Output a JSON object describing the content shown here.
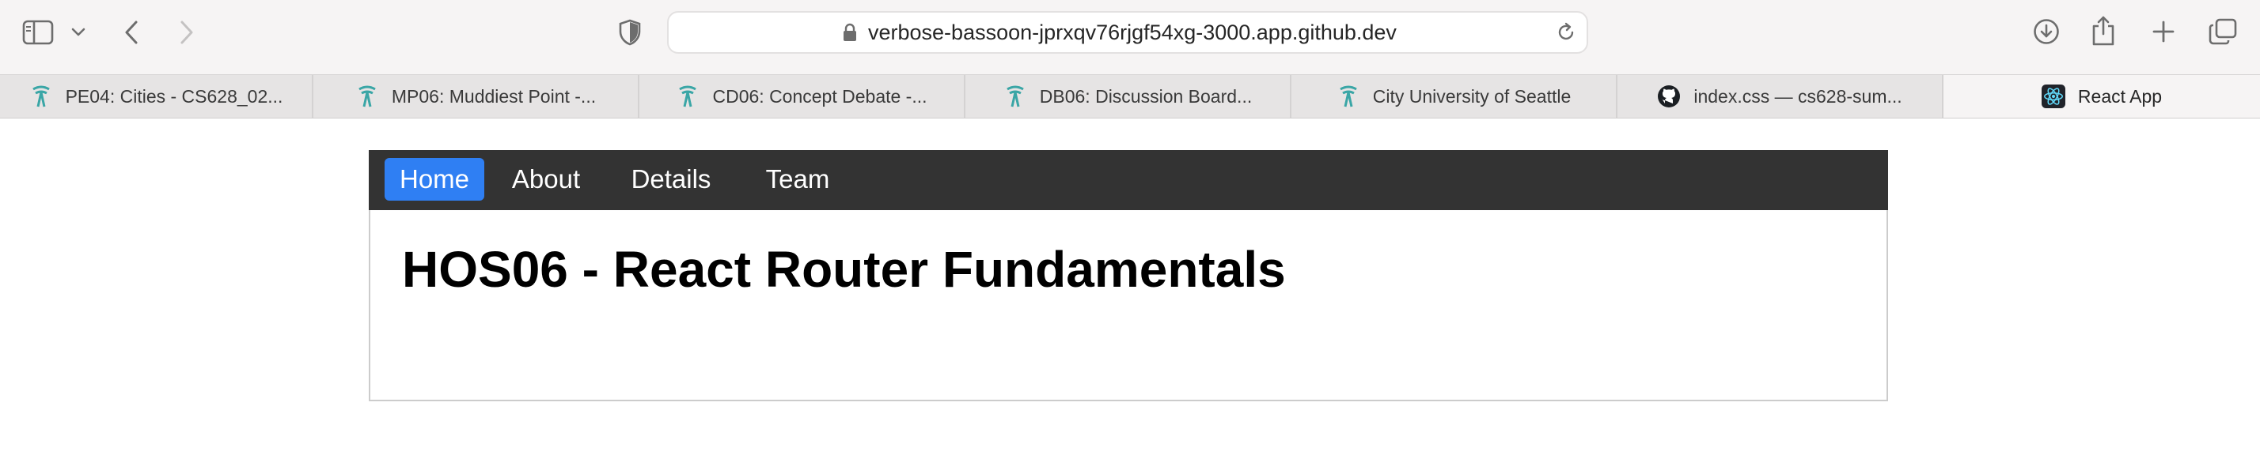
{
  "browser": {
    "url": "verbose-bassoon-jprxqv76rjgf54xg-3000.app.github.dev",
    "icons": [
      "sidebar-icon",
      "chevron-down-icon",
      "back-arrow-icon",
      "forward-arrow-icon",
      "shield-icon",
      "lock-icon",
      "reload-icon",
      "download-icon",
      "share-icon",
      "plus-icon",
      "tabs-overview-icon"
    ],
    "tabs": [
      {
        "label": "PE04: Cities - CS628_02...",
        "icon": "canvas-tower-icon"
      },
      {
        "label": "MP06: Muddiest Point -...",
        "icon": "canvas-tower-icon"
      },
      {
        "label": "CD06: Concept Debate -...",
        "icon": "canvas-tower-icon"
      },
      {
        "label": "DB06: Discussion Board...",
        "icon": "canvas-tower-icon"
      },
      {
        "label": "City University of Seattle",
        "icon": "canvas-tower-icon"
      },
      {
        "label": "index.css — cs628-sum...",
        "icon": "github-icon"
      },
      {
        "label": "React App",
        "icon": "react-icon",
        "active": true
      }
    ]
  },
  "app": {
    "nav": [
      {
        "label": "Home",
        "active": true
      },
      {
        "label": "About"
      },
      {
        "label": "Details"
      },
      {
        "label": "Team"
      }
    ],
    "title": "HOS06 - React Router Fundamentals"
  },
  "colors": {
    "nav_bg": "#333333",
    "nav_active": "#2f7ff3",
    "tab_icon_teal": "#3aa6a6"
  }
}
